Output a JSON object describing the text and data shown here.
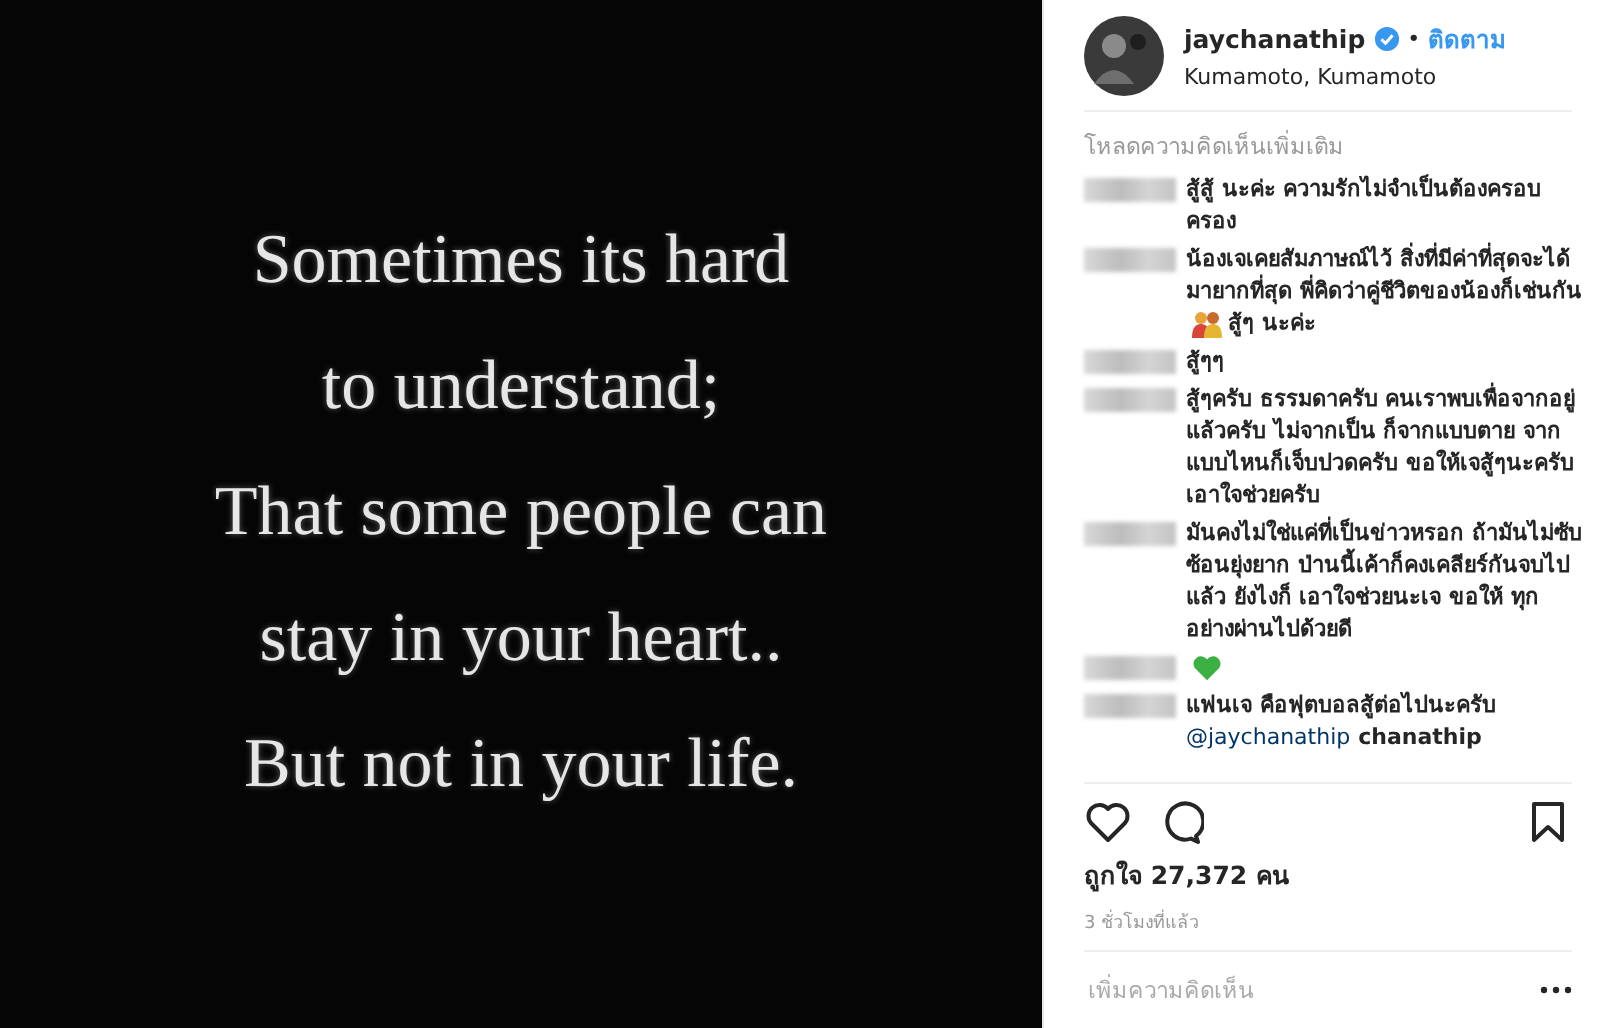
{
  "post_image": {
    "quote_lines": [
      "Sometimes its hard",
      "to understand;",
      "That some people can",
      "stay in your heart..",
      "But not in your life."
    ]
  },
  "header": {
    "username": "jaychanathip",
    "verified": true,
    "separator": "•",
    "follow": "ติดตาม",
    "location": "Kumamoto, Kumamoto"
  },
  "load_more": "โหลดความคิดเห็นเพิ่มเติม",
  "comments": [
    {
      "segments": [
        {
          "kind": "text",
          "text": "สู้สู้ นะค่ะ ความรักไม่จำเป็นต้องครอบครอง"
        }
      ]
    },
    {
      "segments": [
        {
          "kind": "text",
          "text": "น้องเจเคยสัมภาษณ์ไว้ สิ่งที่มีค่าที่สุดจะได้มายากที่สุด พี่คิดว่าคู่ชีวิตของน้องก็เช่นกัน"
        },
        {
          "kind": "couple-emoji"
        },
        {
          "kind": "text",
          "text": "สู้ๆ นะค่ะ"
        }
      ]
    },
    {
      "segments": [
        {
          "kind": "text",
          "text": "สู้ๆๆ"
        }
      ]
    },
    {
      "segments": [
        {
          "kind": "text",
          "text": "สู้ๆครับ ธรรมดาครับ คนเราพบเพื่อจากอยู่แล้วครับ ไม่จากเป็น ก็จากแบบตาย จากแบบไหนก็เจ็บปวดครับ ขอให้เจสู้ๆนะครับ เอาใจช่วยครับ"
        }
      ]
    },
    {
      "segments": [
        {
          "kind": "text",
          "text": "มันคงไม่ใช่แค่ที่เป็นข่าวหรอก ถ้ามันไม่ซับซ้อนยุ่งยาก ป่านนี้เค้าก็คงเคลียร์กันจบไปแล้ว ยังไงก็ เอาใจช่วยนะเจ ขอให้ ทุกอย่างผ่านไปด้วยดี"
        }
      ]
    },
    {
      "segments": [
        {
          "kind": "heart-emoji",
          "color": "#3cb043"
        }
      ]
    },
    {
      "segments": [
        {
          "kind": "text",
          "text": "แฟนเจ คือฟุตบอลสู้ต่อไปนะครับ"
        },
        {
          "kind": "mention",
          "text": "@jaychanathip"
        },
        {
          "kind": "text",
          "text": "chanathip"
        }
      ]
    }
  ],
  "likes": "ถูกใจ 27,372 คน",
  "time": "3 ชั่วโมงที่แล้ว",
  "add_comment": {
    "placeholder": "เพิ่มความคิดเห็น"
  }
}
